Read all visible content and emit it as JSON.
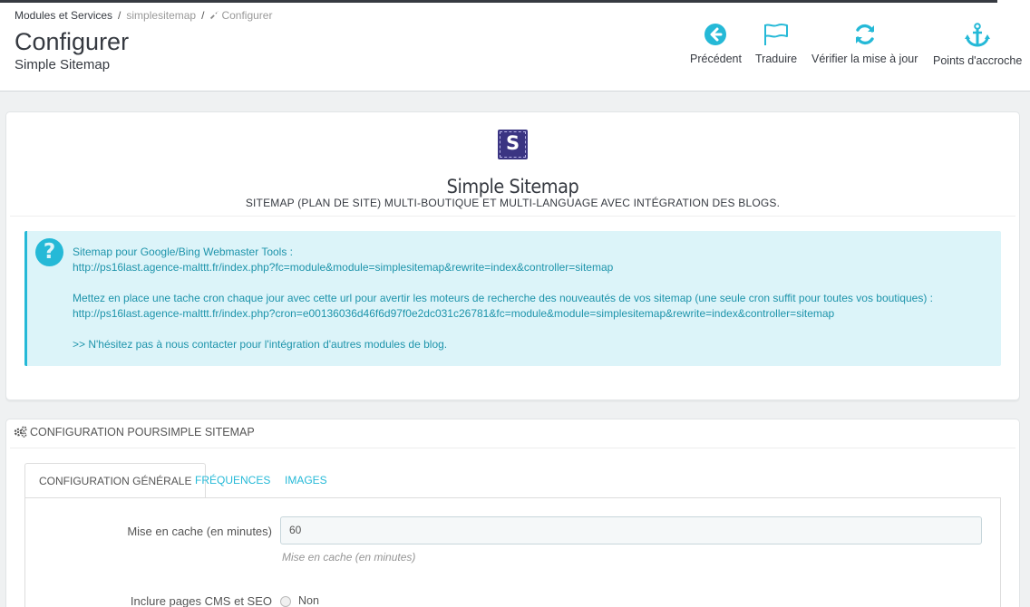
{
  "breadcrumb": {
    "item1": "Modules et Services",
    "item2": "simplesitemap",
    "item3": "Configurer"
  },
  "page": {
    "title": "Configurer",
    "subtitle": "Simple Sitemap"
  },
  "toolbar": {
    "back_label": "Précédent",
    "translate_label": "Traduire",
    "update_label": "Vérifier la mise à jour",
    "hooks_label": "Points d'accroche",
    "accent_color": "#25b9d7"
  },
  "module": {
    "logo_letter": "S",
    "title": "Simple Sitemap",
    "description": "SITEMAP (PLAN DE SITE) MULTI-BOUTIQUE ET MULTI-LANGUAGE AVEC INTÉGRATION DES BLOGS."
  },
  "info_alert": {
    "icon": "question-icon",
    "icon_glyph": "?",
    "line1": "Sitemap pour Google/Bing Webmaster Tools :",
    "line2": "http://ps16last.agence-malttt.fr/index.php?fc=module&module=simplesitemap&rewrite=index&controller=sitemap",
    "line3": "Mettez en place une tache cron chaque jour avec cette url pour avertir les moteurs de recherche des nouveautés de vos sitemap (une seule cron suffit pour toutes vos boutiques) :",
    "line4": "http://ps16last.agence-malttt.fr/index.php?cron=e00136036d46f6d97f0e2dc031c26781&fc=module&module=simplesitemap&rewrite=index&controller=sitemap",
    "line5": ">> N'hésitez pas à nous contacter pour l'intégration d'autres modules de blog.",
    "background_color": "#dcf4f9",
    "text_color": "#1e94ab"
  },
  "config_panel": {
    "header": "CONFIGURATION POURSIMPLE SITEMAP",
    "tabs": [
      {
        "label": "CONFIGURATION GÉNÉRALE",
        "active": true
      },
      {
        "label": "FRÉQUENCES",
        "active": false
      },
      {
        "label": "IMAGES",
        "active": false
      }
    ],
    "cache_label": "Mise en cache (en minutes)",
    "cache_value": "60",
    "cache_help": "Mise en cache (en minutes)",
    "cms_label": "Inclure pages CMS et SEO",
    "cms_option": "Non"
  }
}
